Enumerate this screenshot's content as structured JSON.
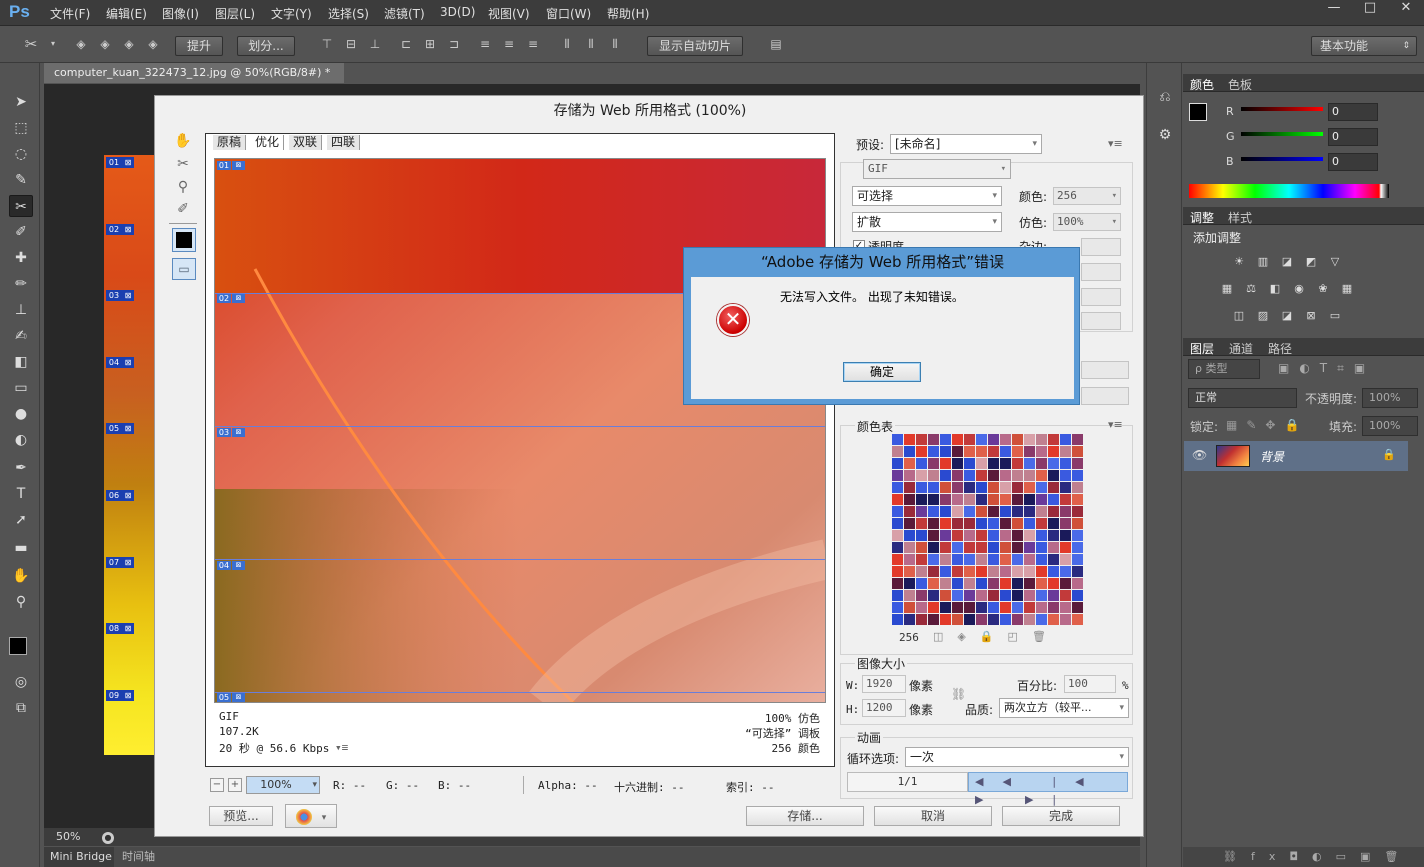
{
  "app": {
    "logo": "Ps"
  },
  "menu": [
    "文件(F)",
    "编辑(E)",
    "图像(I)",
    "图层(L)",
    "文字(Y)",
    "选择(S)",
    "滤镜(T)",
    "3D(D)",
    "视图(V)",
    "窗口(W)",
    "帮助(H)"
  ],
  "window_controls": {
    "minimize": "—",
    "restore": "□",
    "close": "✕"
  },
  "options": {
    "promote": "提升",
    "divide": "划分...",
    "show_auto_slices": "显示自动切片",
    "workspace": "基本功能"
  },
  "document": {
    "tab_title": "computer_kuan_322473_12.jpg @ 50%(RGB/8#) *",
    "tab_close": "×",
    "zoom": "50%"
  },
  "slices": [
    "01",
    "02",
    "03",
    "04",
    "05",
    "06",
    "07",
    "08",
    "09"
  ],
  "bottom_tabs": [
    "Mini Bridge",
    "时间轴"
  ],
  "color_panel": {
    "tabs": [
      "颜色",
      "色板"
    ],
    "r_label": "R",
    "g_label": "G",
    "b_label": "B",
    "r": "0",
    "g": "0",
    "b": "0"
  },
  "adjust_panel": {
    "tabs": [
      "调整",
      "样式"
    ],
    "title": "添加调整"
  },
  "layers_panel": {
    "tabs": [
      "图层",
      "通道",
      "路径"
    ],
    "filter": "ρ 类型",
    "blend_mode": "正常",
    "opacity_label": "不透明度:",
    "opacity": "100%",
    "lock_label": "锁定:",
    "fill_label": "填充:",
    "fill": "100%",
    "layer_name": "背景"
  },
  "sfw": {
    "title": "存储为 Web 所用格式 (100%)",
    "view_tabs": [
      "原稿",
      "优化",
      "双联",
      "四联"
    ],
    "info_left": [
      "GIF",
      "107.2K",
      "20 秒 @ 56.6 Kbps"
    ],
    "info_right": [
      "100% 仿色",
      "“可选择” 调板",
      "256 颜色"
    ],
    "preset_label": "预设:",
    "preset_value": "[未命名]",
    "format": "GIF",
    "reduction": "可选择",
    "colors_label": "颜色:",
    "colors": "256",
    "dither_algo": "扩散",
    "dither_label": "仿色:",
    "dither": "100%",
    "transparency": "透明度",
    "matte_label": "杂边:",
    "color_table_label": "颜色表",
    "color_count": "256",
    "image_size_label": "图像大小",
    "w_label": "W:",
    "w": "1920",
    "h_label": "H:",
    "h": "1200",
    "px_label": "像素",
    "percent_label": "百分比:",
    "percent": "100",
    "percent_unit": "%",
    "quality_label": "品质:",
    "quality": "两次立方（较平...",
    "animation_label": "动画",
    "loop_label": "循环选项:",
    "loop": "一次",
    "frame": "1/1",
    "zoom": "100%",
    "readout": {
      "r": "R: --",
      "g": "G: --",
      "b": "B: --",
      "alpha": "Alpha: --",
      "hex": "十六进制: --",
      "index": "索引: --"
    },
    "buttons": {
      "preview": "预览...",
      "save": "存储...",
      "cancel": "取消",
      "done": "完成"
    }
  },
  "error_dialog": {
    "title": "“Adobe 存储为 Web 所用格式”错误",
    "message": "无法写入文件。 出现了未知错误。",
    "ok": "确定"
  }
}
